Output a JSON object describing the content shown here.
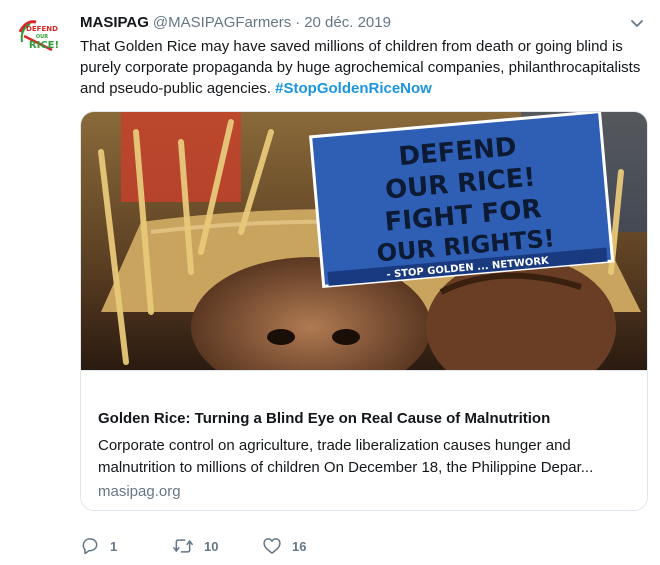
{
  "tweet": {
    "name": "MASIPAG",
    "handle": "@MASIPAGFarmers",
    "separator": "·",
    "date": "20 déc. 2019",
    "text": "That Golden Rice may have saved millions of children from death or going blind is purely corporate propaganda by huge agrochemical companies, philanthrocapitalists and pseudo-public agencies.",
    "hashtag": "#StopGoldenRiceNow"
  },
  "avatar": {
    "logo_text": [
      "DEFEND",
      "OUR",
      "RICE!"
    ]
  },
  "card": {
    "image_sign_lines": [
      "DEFEND",
      "OUR RICE!",
      "FIGHT FOR",
      "OUR RIGHTS!",
      "- STOP GOLDEN ... NETWORK"
    ],
    "title": "Golden Rice: Turning a Blind Eye on Real Cause of Malnutrition",
    "description": "Corporate control on agriculture, trade liberalization causes hunger and malnutrition to millions of children On December 18, the Philippine Depar...",
    "domain": "masipag.org"
  },
  "actions": {
    "reply_count": "1",
    "retweet_count": "10",
    "like_count": "16"
  },
  "colors": {
    "link": "#1b95e0",
    "muted": "#657786",
    "border": "#e1e8ed",
    "logo_green": "#2e9e3a",
    "logo_red": "#d62828"
  }
}
